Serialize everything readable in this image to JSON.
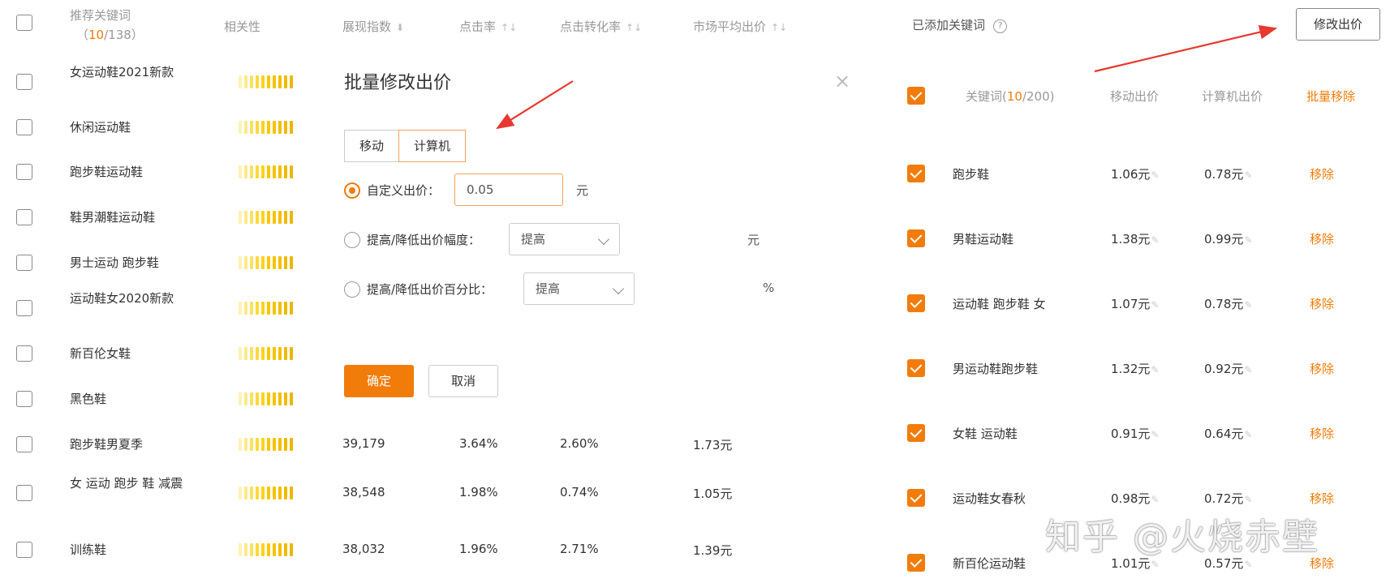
{
  "left_table": {
    "headers": {
      "keyword": "推荐关键词",
      "count_selected": "10",
      "count_total": "/138",
      "relevance": "相关性",
      "impressions": "展现指数",
      "ctr": "点击率",
      "cvr": "点击转化率",
      "avg_bid": "市场平均出价"
    },
    "rows": [
      {
        "keyword": "女运动鞋2021新款",
        "relevance": 10,
        "impressions": "",
        "ctr": "",
        "cvr": "",
        "avg_bid": ""
      },
      {
        "keyword": "休闲运动鞋",
        "relevance": 10,
        "impressions": "",
        "ctr": "",
        "cvr": "",
        "avg_bid": ""
      },
      {
        "keyword": "跑步鞋运动鞋",
        "relevance": 10,
        "impressions": "",
        "ctr": "",
        "cvr": "",
        "avg_bid": ""
      },
      {
        "keyword": "鞋男潮鞋运动鞋",
        "relevance": 10,
        "impressions": "",
        "ctr": "",
        "cvr": "",
        "avg_bid": ""
      },
      {
        "keyword": "男士运动 跑步鞋",
        "relevance": 10,
        "impressions": "",
        "ctr": "",
        "cvr": "",
        "avg_bid": ""
      },
      {
        "keyword": "运动鞋女2020新款",
        "relevance": 10,
        "impressions": "",
        "ctr": "",
        "cvr": "",
        "avg_bid": ""
      },
      {
        "keyword": "新百伦女鞋",
        "relevance": 10,
        "impressions": "",
        "ctr": "",
        "cvr": "",
        "avg_bid": ""
      },
      {
        "keyword": "黑色鞋",
        "relevance": 10,
        "impressions": "",
        "ctr": "",
        "cvr": "",
        "avg_bid": ""
      },
      {
        "keyword": "跑步鞋男夏季",
        "relevance": 10,
        "impressions": "39,179",
        "ctr": "3.64%",
        "cvr": "2.60%",
        "avg_bid": "1.73元"
      },
      {
        "keyword": "女 运动 跑步 鞋 减震",
        "relevance": 10,
        "impressions": "38,548",
        "ctr": "1.98%",
        "cvr": "0.74%",
        "avg_bid": "1.05元"
      },
      {
        "keyword": "训练鞋",
        "relevance": 10,
        "impressions": "38,032",
        "ctr": "1.96%",
        "cvr": "2.71%",
        "avg_bid": "1.39元"
      }
    ]
  },
  "modal": {
    "title": "批量修改出价",
    "tabs": [
      {
        "label": "移动",
        "active": false
      },
      {
        "label": "计算机",
        "active": true
      }
    ],
    "custom_bid": {
      "label": "自定义出价：",
      "value": "0.05",
      "unit": "元",
      "selected": true
    },
    "adjust_amount": {
      "label": "提高/降低出价幅度：",
      "select_value": "提高",
      "unit": "元",
      "selected": false
    },
    "adjust_percent": {
      "label": "提高/降低出价百分比：",
      "select_value": "提高",
      "unit": "%",
      "selected": false
    },
    "confirm_label": "确定",
    "cancel_label": "取消",
    "close_symbol": "×"
  },
  "right_panel": {
    "title": "已添加关键词",
    "help_symbol": "?",
    "edit_bid_button": "修改出价",
    "headers": {
      "keyword": "关键词(",
      "count_selected": "10",
      "count_total": "/200)",
      "mobile_bid": "移动出价",
      "pc_bid": "计算机出价",
      "bulk_remove": "批量移除"
    },
    "rows": [
      {
        "keyword": "跑步鞋",
        "mobile_bid": "1.06元",
        "pc_bid": "0.78元",
        "remove": "移除"
      },
      {
        "keyword": "男鞋运动鞋",
        "mobile_bid": "1.38元",
        "pc_bid": "0.99元",
        "remove": "移除"
      },
      {
        "keyword": "运动鞋 跑步鞋 女",
        "mobile_bid": "1.07元",
        "pc_bid": "0.78元",
        "remove": "移除"
      },
      {
        "keyword": "男运动鞋跑步鞋",
        "mobile_bid": "1.32元",
        "pc_bid": "0.92元",
        "remove": "移除"
      },
      {
        "keyword": "女鞋 运动鞋",
        "mobile_bid": "0.91元",
        "pc_bid": "0.64元",
        "remove": "移除"
      },
      {
        "keyword": "运动鞋女春秋",
        "mobile_bid": "0.98元",
        "pc_bid": "0.72元",
        "remove": "移除"
      },
      {
        "keyword": "新百伦运动鞋",
        "mobile_bid": "1.01元",
        "pc_bid": "0.57元",
        "remove": "移除"
      }
    ]
  },
  "watermark": "知乎 @火烧赤壁",
  "colors": {
    "accent": "#f27c0a",
    "arrow": "#e8382f",
    "relevance_bar": "#f5c400"
  }
}
